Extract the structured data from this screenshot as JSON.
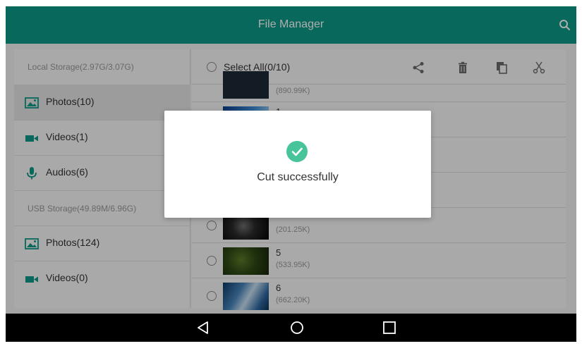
{
  "header": {
    "title": "File Manager",
    "search_icon": "search-icon"
  },
  "sidebar": {
    "local_title": "Local Storage(2.97G/3.07G)",
    "usb_title": "USB Storage(49.89M/6.96G)",
    "local_items": [
      {
        "label": "Photos(10)",
        "icon": "image-icon",
        "active": true
      },
      {
        "label": "Videos(1)",
        "icon": "video-camera-icon"
      },
      {
        "label": "Audios(6)",
        "icon": "microphone-icon"
      }
    ],
    "usb_items": [
      {
        "label": "Photos(124)",
        "icon": "image-icon"
      },
      {
        "label": "Videos(0)",
        "icon": "video-camera-icon"
      }
    ]
  },
  "toolbar": {
    "select_all_label": "Select All(0/10)",
    "actions": [
      "share-icon",
      "delete-icon",
      "copy-icon",
      "cut-icon"
    ]
  },
  "files": [
    {
      "name": "",
      "size": "(890.99K)"
    },
    {
      "name": "1",
      "size": ""
    },
    {
      "name": "",
      "size": ""
    },
    {
      "name": "",
      "size": ""
    },
    {
      "name": "",
      "size": "(201.25K)"
    },
    {
      "name": "5",
      "size": "(533.95K)"
    },
    {
      "name": "6",
      "size": "(662.20K)"
    }
  ],
  "dialog": {
    "message": "Cut successfully",
    "icon": "check-circle-icon"
  },
  "navbar": {
    "buttons": [
      "back-icon",
      "home-icon",
      "recents-icon"
    ]
  },
  "colors": {
    "accent": "#0d9a86",
    "success": "#47c49a",
    "navbar": "#000000"
  }
}
